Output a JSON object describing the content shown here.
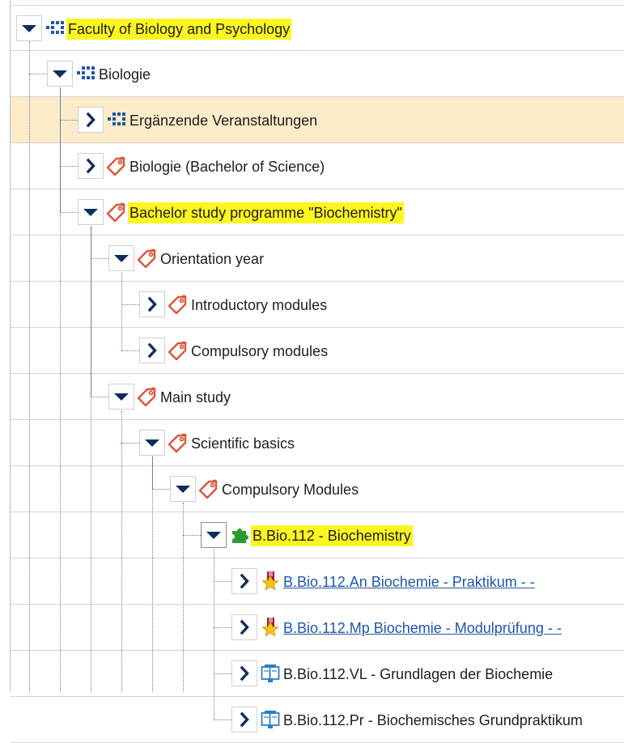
{
  "colors": {
    "highlight": "#fcf620",
    "hover_row": "#fbebc8",
    "toggle_arrow": "#0e2d5c",
    "link": "#1f56a8",
    "org_icon": "#1f56a8",
    "tag_icon": "#d9573a",
    "module_icon": "#2e9a2e",
    "exam_icon_star": "#f4c21a",
    "exam_icon_badge": "#9b1c3c",
    "course_icon": "#2a7fc4"
  },
  "tree": {
    "nodes": [
      {
        "name": "tree-node-faculty",
        "label": "Faculty of Biology and Psychology",
        "depth": 0,
        "expanded": true,
        "icon": "org-unit-icon",
        "highlight": true,
        "link": false,
        "hover": false
      },
      {
        "name": "tree-node-biologie",
        "label": "Biologie",
        "depth": 1,
        "expanded": true,
        "icon": "org-unit-icon",
        "highlight": false,
        "link": false,
        "hover": false
      },
      {
        "name": "tree-node-ergaenzende-veranstaltungen",
        "label": "Ergänzende Veranstaltungen",
        "depth": 2,
        "expanded": false,
        "icon": "org-unit-icon",
        "highlight": false,
        "link": false,
        "hover": true
      },
      {
        "name": "tree-node-biologie-bsc",
        "label": "Biologie (Bachelor of Science)",
        "depth": 2,
        "expanded": false,
        "icon": "tag-icon",
        "highlight": false,
        "link": false,
        "hover": false
      },
      {
        "name": "tree-node-bachelor-biochemistry",
        "label": "Bachelor study programme \"Biochemistry\"",
        "depth": 2,
        "expanded": true,
        "icon": "tag-icon",
        "highlight": true,
        "link": false,
        "hover": false
      },
      {
        "name": "tree-node-orientation-year",
        "label": "Orientation year",
        "depth": 3,
        "expanded": true,
        "icon": "tag-icon",
        "highlight": false,
        "link": false,
        "hover": false
      },
      {
        "name": "tree-node-introductory-modules",
        "label": "Introductory modules",
        "depth": 4,
        "expanded": false,
        "icon": "tag-icon",
        "highlight": false,
        "link": false,
        "hover": false
      },
      {
        "name": "tree-node-compulsory-modules-orientation",
        "label": "Compulsory modules",
        "depth": 4,
        "expanded": false,
        "icon": "tag-icon",
        "highlight": false,
        "link": false,
        "hover": false
      },
      {
        "name": "tree-node-main-study",
        "label": "Main study",
        "depth": 3,
        "expanded": true,
        "icon": "tag-icon",
        "highlight": false,
        "link": false,
        "hover": false
      },
      {
        "name": "tree-node-scientific-basics",
        "label": "Scientific basics",
        "depth": 4,
        "expanded": true,
        "icon": "tag-icon",
        "highlight": false,
        "link": false,
        "hover": false
      },
      {
        "name": "tree-node-compulsory-modules-main",
        "label": "Compulsory Modules",
        "depth": 5,
        "expanded": true,
        "icon": "tag-icon",
        "highlight": false,
        "link": false,
        "hover": false
      },
      {
        "name": "tree-node-bbio112",
        "label": "B.Bio.112 - Biochemistry",
        "depth": 6,
        "expanded": true,
        "icon": "module-icon",
        "highlight": true,
        "link": false,
        "hover": false,
        "selected": true
      },
      {
        "name": "tree-node-bbio112-an",
        "label": "B.Bio.112.An Biochemie - Praktikum - -",
        "depth": 7,
        "expanded": false,
        "icon": "exam-icon",
        "highlight": false,
        "link": true,
        "hover": false
      },
      {
        "name": "tree-node-bbio112-mp",
        "label": "B.Bio.112.Mp Biochemie - Modulprüfung - -",
        "depth": 7,
        "expanded": false,
        "icon": "exam-icon",
        "highlight": false,
        "link": true,
        "hover": false
      },
      {
        "name": "tree-node-bbio112-vl",
        "label": "B.Bio.112.VL - Grundlagen der Biochemie",
        "depth": 7,
        "expanded": false,
        "icon": "course-icon",
        "highlight": false,
        "link": false,
        "hover": false
      },
      {
        "name": "tree-node-bbio112-pr",
        "label": "B.Bio.112.Pr - Biochemisches Grundpraktikum",
        "depth": 7,
        "expanded": false,
        "icon": "course-icon",
        "highlight": false,
        "link": false,
        "hover": false
      }
    ]
  }
}
